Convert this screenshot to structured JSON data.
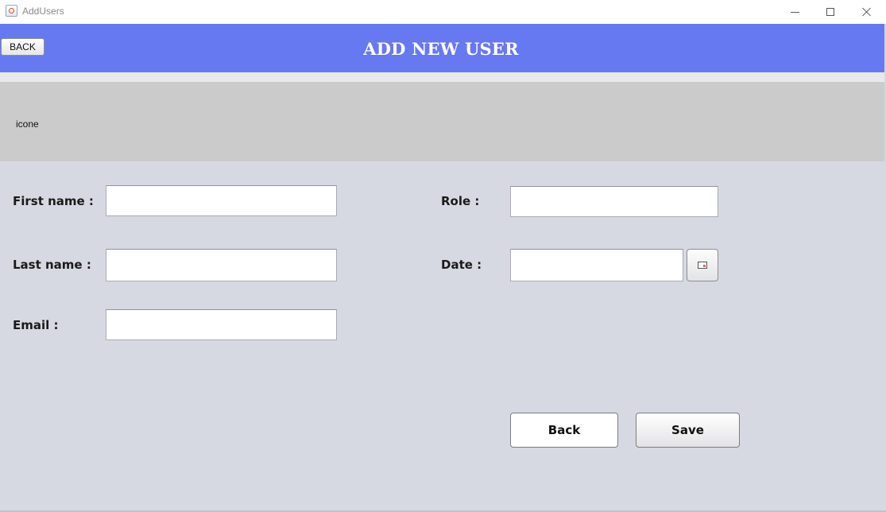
{
  "window": {
    "title": "AddUsers",
    "controls": [
      "minimize-icon",
      "maximize-icon",
      "close-icon"
    ]
  },
  "header": {
    "title": "ADD NEW USER",
    "back_button": "BACK",
    "background": "#6779f0"
  },
  "icon_area": {
    "label": "icone"
  },
  "form": {
    "first_name": {
      "label": "First name :",
      "value": "",
      "placeholder": ""
    },
    "last_name": {
      "label": "Last name :",
      "value": "",
      "placeholder": ""
    },
    "email": {
      "label": "Email :",
      "value": "",
      "placeholder": ""
    },
    "role": {
      "label": "Role :",
      "value": "",
      "placeholder": ""
    },
    "date": {
      "label": "Date :",
      "value": "",
      "placeholder": "",
      "picker_icon": "calendar-icon"
    }
  },
  "actions": {
    "back_label": "Back",
    "save_label": "Save"
  }
}
